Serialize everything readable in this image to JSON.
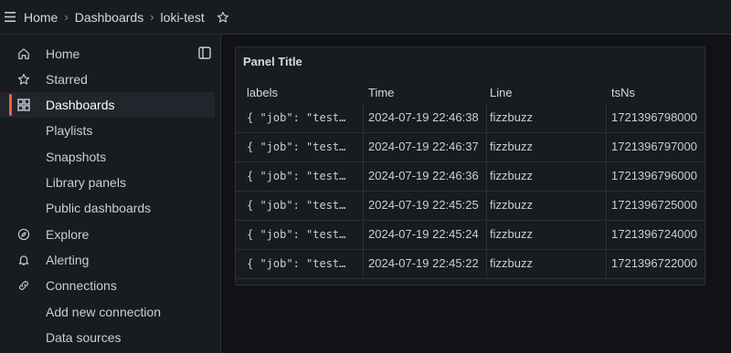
{
  "breadcrumb": {
    "home": "Home",
    "dashboards": "Dashboards",
    "current": "loki-test",
    "separator": "›"
  },
  "sidebar": {
    "items": [
      {
        "label": "Home",
        "icon": "home-icon"
      },
      {
        "label": "Starred",
        "icon": "star-icon"
      },
      {
        "label": "Dashboards",
        "icon": "apps-icon",
        "active": true
      },
      {
        "label": "Playlists"
      },
      {
        "label": "Snapshots"
      },
      {
        "label": "Library panels"
      },
      {
        "label": "Public dashboards"
      },
      {
        "label": "Explore",
        "icon": "compass-icon"
      },
      {
        "label": "Alerting",
        "icon": "bell-icon"
      },
      {
        "label": "Connections",
        "icon": "link-icon"
      },
      {
        "label": "Add new connection"
      },
      {
        "label": "Data sources"
      }
    ]
  },
  "panel": {
    "title": "Panel Title",
    "columns": [
      "labels",
      "Time",
      "Line",
      "tsNs"
    ],
    "rows": [
      {
        "labels": "{ \"job\": \"test…",
        "time": "2024-07-19 22:46:38",
        "line": "fizzbuzz",
        "tsNs": "1721396798000"
      },
      {
        "labels": "{ \"job\": \"test…",
        "time": "2024-07-19 22:46:37",
        "line": "fizzbuzz",
        "tsNs": "1721396797000"
      },
      {
        "labels": "{ \"job\": \"test…",
        "time": "2024-07-19 22:46:36",
        "line": "fizzbuzz",
        "tsNs": "1721396796000"
      },
      {
        "labels": "{ \"job\": \"test…",
        "time": "2024-07-19 22:45:25",
        "line": "fizzbuzz",
        "tsNs": "1721396725000"
      },
      {
        "labels": "{ \"job\": \"test…",
        "time": "2024-07-19 22:45:24",
        "line": "fizzbuzz",
        "tsNs": "1721396724000"
      },
      {
        "labels": "{ \"job\": \"test…",
        "time": "2024-07-19 22:45:22",
        "line": "fizzbuzz",
        "tsNs": "1721396722000"
      }
    ]
  },
  "colors": {
    "accent": "#f55f3e",
    "background": "#111217",
    "surface": "#181b1f",
    "border": "#2c3039"
  }
}
